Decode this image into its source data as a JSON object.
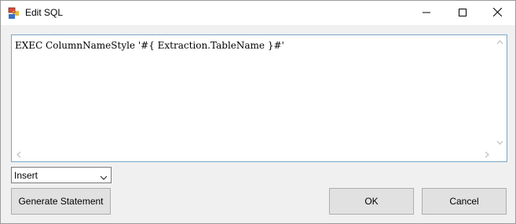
{
  "window": {
    "title": "Edit SQL",
    "app_icon": "sql-app-icon",
    "controls": {
      "minimize_icon": "minimize-icon",
      "maximize_icon": "maximize-icon",
      "close_icon": "close-icon"
    }
  },
  "editor": {
    "content": "EXEC ColumnNameStyle '#{ Extraction.TableName }#'"
  },
  "insert_dropdown": {
    "selected": "Insert"
  },
  "buttons": {
    "generate_label": "Generate Statement",
    "ok_label": "OK",
    "cancel_label": "Cancel"
  },
  "colors": {
    "window_bg": "#f0f0f0",
    "editor_border": "#7aa7c7",
    "button_bg": "#e1e1e1",
    "button_border": "#adadad"
  }
}
